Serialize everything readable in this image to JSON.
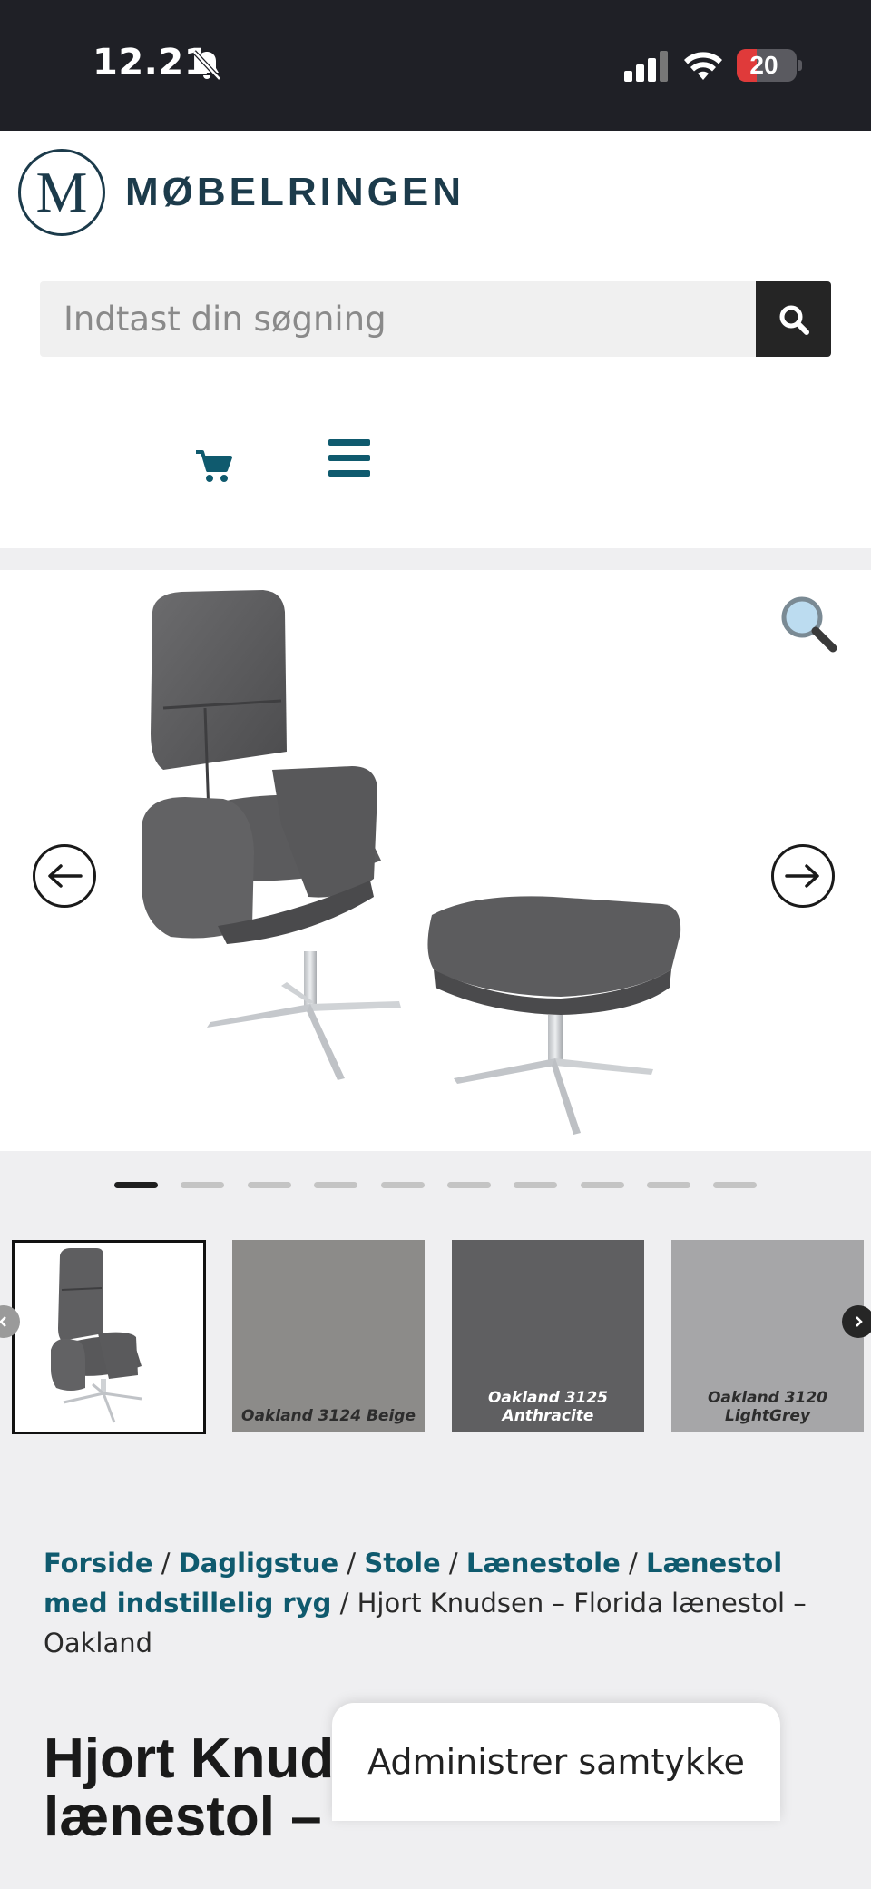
{
  "status_bar": {
    "time": "12.21",
    "battery": "20"
  },
  "header": {
    "logo_letter": "M",
    "logo_text": "MØBELRINGEN",
    "search": {
      "placeholder": "Indtast din søgning"
    }
  },
  "thumbnails": [
    {
      "label": "Oakland 3124 Beige",
      "color": "#8c8b89",
      "text_color": "#2d2d2d"
    },
    {
      "label": "Oakland 3125 Anthracite",
      "color": "#5f5f61",
      "text_color": "#ffffff"
    },
    {
      "label": "Oakland 3120 LightGrey",
      "color": "#a6a6a8",
      "text_color": "#2d2d2d"
    }
  ],
  "breadcrumb": {
    "items": [
      "Forside",
      "Dagligstue",
      "Stole",
      "Lænestole",
      "Lænestol med indstillelig ryg"
    ],
    "current": "Hjort Knudsen – Florida lænestol – Oakland"
  },
  "product": {
    "title": "Hjort Knudsen – Florida lænestol – Oakland"
  },
  "consent": {
    "label": "Administrer samtykke"
  },
  "carousel": {
    "active_index": 0,
    "total": 10
  },
  "colors": {
    "brand": "#1c3b4b",
    "link": "#0f5a6e",
    "accent": "#0f5a6e"
  }
}
